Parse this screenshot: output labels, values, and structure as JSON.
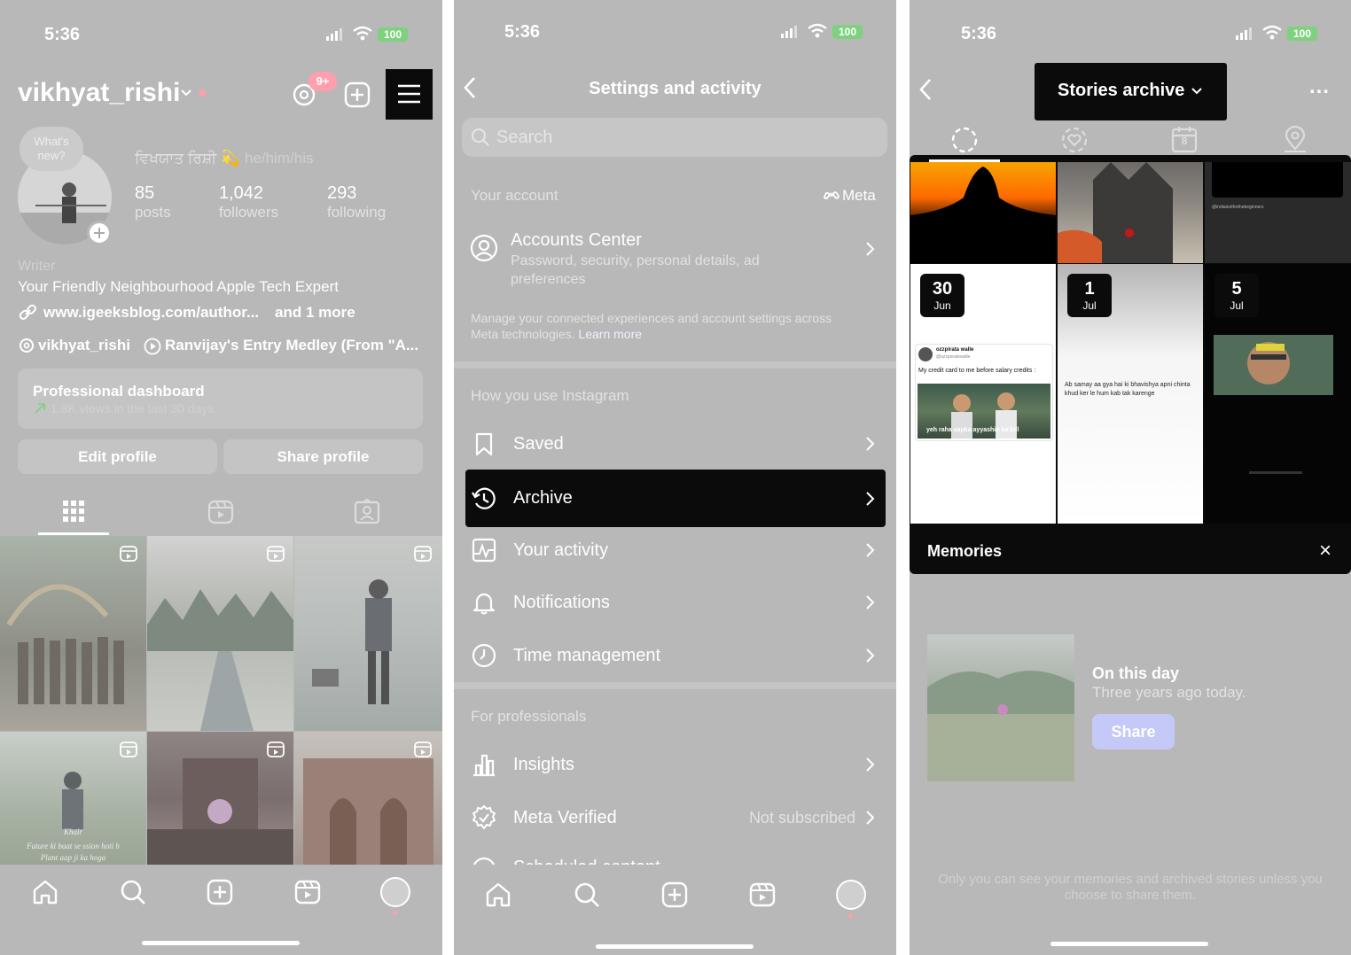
{
  "status": {
    "time_1": "5:36",
    "time_2": "5:36",
    "time_3": "5:36",
    "battery": "100"
  },
  "profile": {
    "username": "vikhyat_rishi",
    "threads_badge": "9+",
    "note_bubble": "What's new?",
    "display_name": "ਵਿਖਯਾਤ ਰਿਸ਼ੀ 💫",
    "pronouns": "he/him/his",
    "stats": [
      {
        "value": "85",
        "label": "posts"
      },
      {
        "value": "1,042",
        "label": "followers"
      },
      {
        "value": "293",
        "label": "following"
      }
    ],
    "category": "Writer",
    "bio": "Your Friendly Neighbourhood Apple Tech Expert",
    "link": "www.igeeksblog.com/author...",
    "link_more": "and 1 more",
    "threads_handle": "vikhyat_rishi",
    "music": "Ranvijay's Entry Medley (From \"A...",
    "dashboard_title": "Professional dashboard",
    "dashboard_sub": "1.8K views in the last 30 days.",
    "edit_btn": "Edit profile",
    "share_btn": "Share profile",
    "post_caption_line1": "Future ki baat se ssion hoti h",
    "post_caption_line2": "Plant aap ji ka hoga",
    "post_caption_top": "Khair"
  },
  "settings": {
    "title": "Settings and activity",
    "search_placeholder": "Search",
    "your_account": "Your account",
    "meta_label": "Meta",
    "accounts_center_title": "Accounts Center",
    "accounts_center_sub": "Password, security, personal details, ad preferences",
    "manage_text": "Manage your connected experiences and account settings across Meta technologies.",
    "learn_more": "Learn more",
    "how_you_use": "How you use Instagram",
    "items": [
      {
        "label": "Saved"
      },
      {
        "label": "Archive"
      },
      {
        "label": "Your activity"
      },
      {
        "label": "Notifications"
      },
      {
        "label": "Time management"
      }
    ],
    "for_professionals": "For professionals",
    "pro_items": [
      {
        "label": "Insights"
      },
      {
        "label": "Meta Verified",
        "value": "Not subscribed"
      },
      {
        "label": "Scheduled content"
      }
    ]
  },
  "archive": {
    "title": "Stories archive",
    "more": "…",
    "date_badges": [
      {
        "day": "30",
        "month": "Jun"
      },
      {
        "day": "1",
        "month": "Jul"
      },
      {
        "day": "5",
        "month": "Jul"
      }
    ],
    "tweet_name": "ozzpirata walle",
    "tweet_handle": "@ozzporatewalle",
    "tweet_text": "My credit card to me before salary credits :",
    "meme_caption": "yeh raha aapka ayyashio ka bill",
    "story2_text": "Ab samay aa gya hai ki bhavishya apni chinta khud ker le hum kab tak karenge",
    "story3_tag": "@indiainotforthebeginners",
    "memories_title": "Memories",
    "memories_close": "×",
    "on_this_day": "On this day",
    "years_ago": "Three years ago today.",
    "share_btn": "Share",
    "footer_note": "Only you can see your memories and archived stories unless you choose to share them.",
    "calendar_number": "8"
  },
  "colors": {
    "highlight": "#0b0b0b",
    "share_btn": "#c5c9f8",
    "notification_dot": "#ff9fae"
  }
}
